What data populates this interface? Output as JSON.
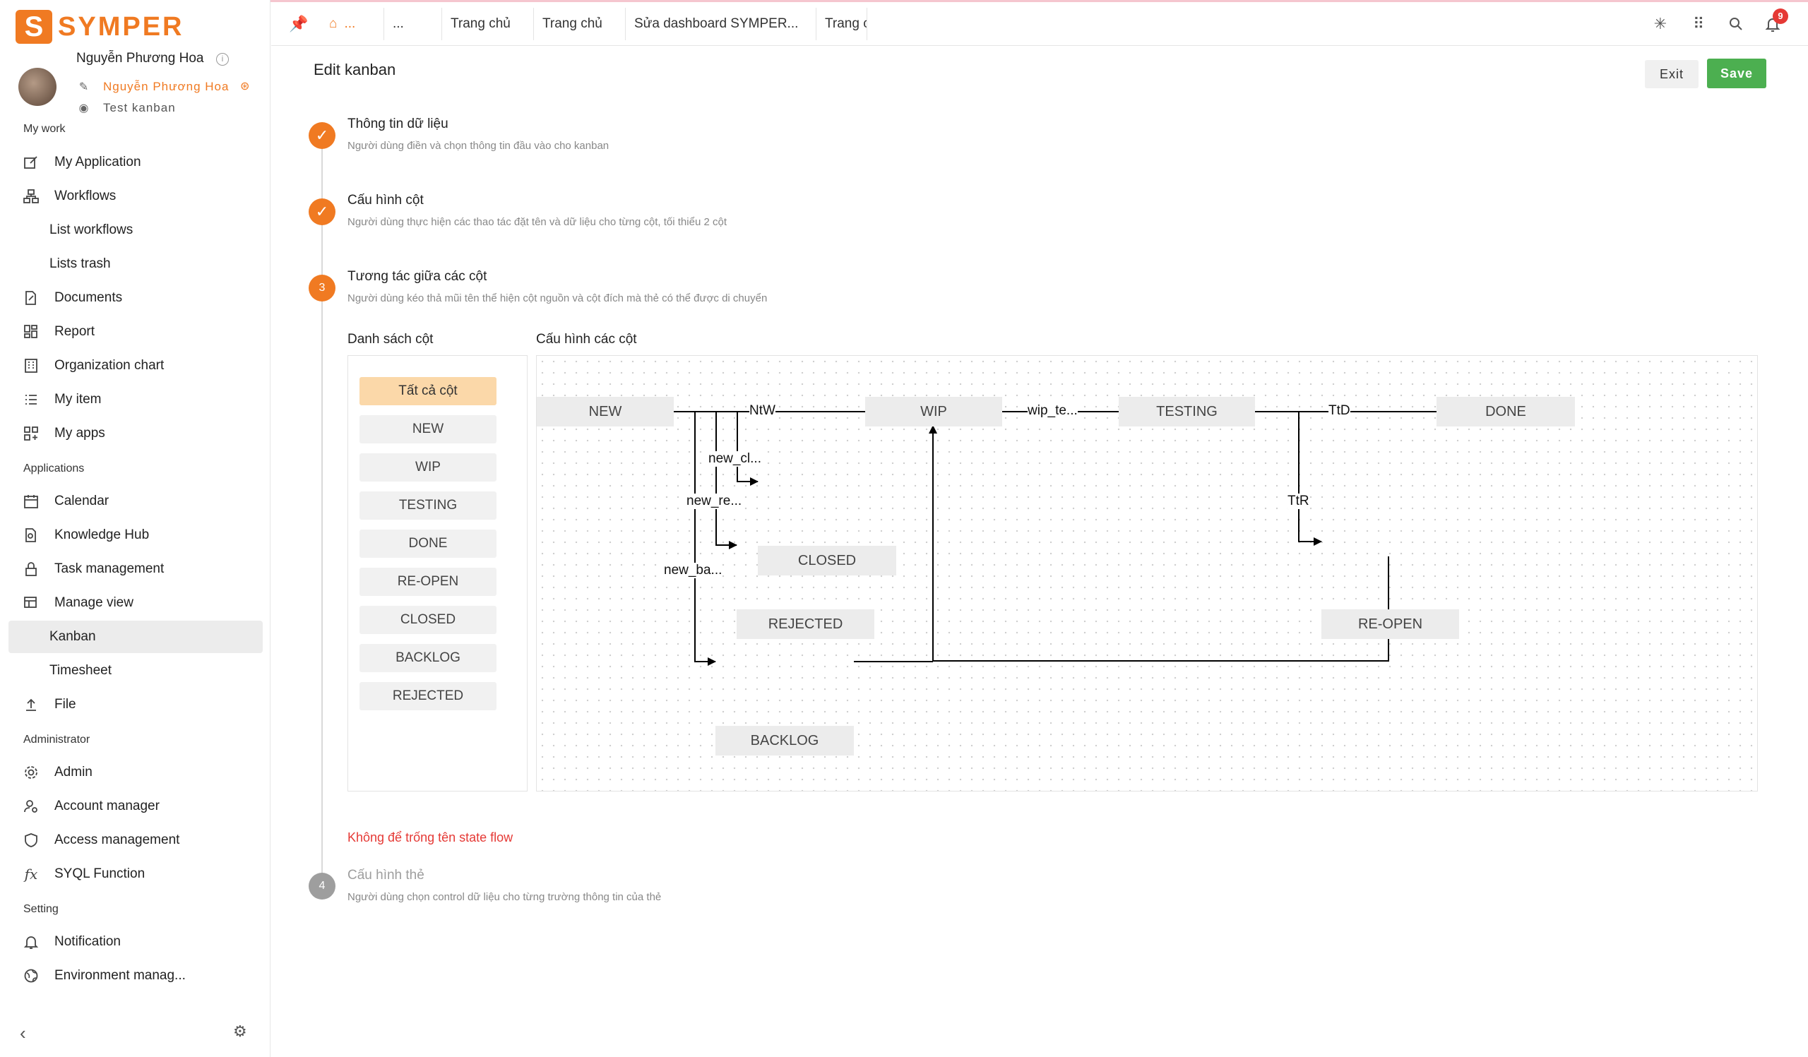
{
  "app": {
    "logo_text": "SYMPER",
    "logo_letter": "S"
  },
  "user": {
    "name": "Nguyễn Phương Hoa",
    "role_primary": "Nguyễn Phương Hoa",
    "role_secondary": "Test kanban"
  },
  "sidebar": {
    "section_my_work": "My work",
    "my_application": "My Application",
    "workflows": "Workflows",
    "list_workflows": "List workflows",
    "lists_trash": "Lists trash",
    "documents": "Documents",
    "report": "Report",
    "organization_chart": "Organization chart",
    "my_item": "My item",
    "my_apps": "My apps",
    "section_applications": "Applications",
    "calendar": "Calendar",
    "knowledge_hub": "Knowledge Hub",
    "task_management": "Task management",
    "manage_view": "Manage view",
    "kanban": "Kanban",
    "timesheet": "Timesheet",
    "file": "File",
    "section_administrator": "Administrator",
    "admin": "Admin",
    "account_manager": "Account manager",
    "access_management": "Access management",
    "sql_function": "SYQL Function",
    "section_setting": "Setting",
    "notification": "Notification",
    "environment": "Environment manag..."
  },
  "tabs": {
    "home": "...",
    "t2": "...",
    "t3": "Trang chủ",
    "t4": "Trang chủ",
    "t5": "Sửa dashboard SYMPER...",
    "t6": "Trang c"
  },
  "topbar": {
    "notification_count": "9"
  },
  "page": {
    "title": "Edit kanban",
    "exit_label": "Exit",
    "save_label": "Save"
  },
  "steps": [
    {
      "title": "Thông tin dữ liệu",
      "desc": "Người dùng điền và chọn thông tin đầu vào cho kanban",
      "state": "done"
    },
    {
      "title": "Cấu hình cột",
      "desc": "Người dùng thực hiện các thao tác đặt tên và dữ liệu cho từng cột, tối thiểu 2 cột",
      "state": "done"
    },
    {
      "number": "3",
      "title": "Tương tác giữa các cột",
      "desc": "Người dùng kéo thả mũi tên thể hiện cột nguồn và cột đích mà thẻ có thể được di chuyển",
      "state": "current"
    },
    {
      "number": "4",
      "title": "Cấu hình thẻ",
      "desc": "Người dùng chọn control dữ liệu cho từng trường thông tin của thẻ",
      "state": "pending"
    }
  ],
  "columns_panel": {
    "label": "Danh sách cột",
    "items": [
      "Tất cả cột",
      "NEW",
      "WIP",
      "TESTING",
      "DONE",
      "RE-OPEN",
      "CLOSED",
      "BACKLOG",
      "REJECTED"
    ]
  },
  "flow_panel": {
    "label": "Cấu hình các cột",
    "nodes": {
      "new": "NEW",
      "wip": "WIP",
      "testing": "TESTING",
      "done": "DONE",
      "closed": "CLOSED",
      "rejected": "REJECTED",
      "reopen": "RE-OPEN",
      "backlog": "BACKLOG"
    },
    "edges": {
      "ntw": "NtW",
      "wip_te": "wip_te...",
      "ttd": "TtD",
      "ttr": "TtR",
      "new_cl": "new_cl...",
      "new_re": "new_re...",
      "new_ba": "new_ba..."
    }
  },
  "error_message": "Không để trống tên state flow"
}
